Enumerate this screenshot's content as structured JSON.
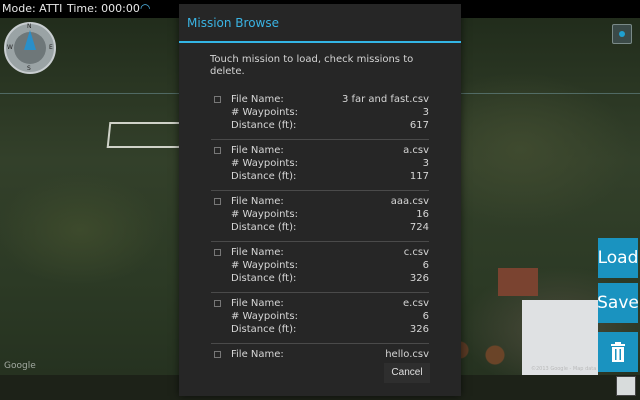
{
  "status": {
    "mode": "Mode: ATTI",
    "time": "Time: 000:00"
  },
  "compass": {
    "n": "N",
    "e": "E",
    "s": "S",
    "w": "W"
  },
  "dialog": {
    "title": "Mission Browse",
    "instructions": "Touch mission to load, check missions to delete.",
    "labels": {
      "file": "File Name:",
      "waypoints": "# Waypoints:",
      "distance": "Distance (ft):"
    },
    "missions": [
      {
        "file": "3 far and fast.csv",
        "waypoints": "3",
        "distance": "617"
      },
      {
        "file": "a.csv",
        "waypoints": "3",
        "distance": "117"
      },
      {
        "file": "aaa.csv",
        "waypoints": "16",
        "distance": "724"
      },
      {
        "file": "c.csv",
        "waypoints": "6",
        "distance": "326"
      },
      {
        "file": "e.csv",
        "waypoints": "6",
        "distance": "326"
      },
      {
        "file": "hello.csv"
      }
    ],
    "cancel": "Cancel"
  },
  "controls": {
    "load": "Load",
    "save": "Save"
  },
  "map": {
    "attribution": "Google",
    "copyright": "©2013 Google - Map data"
  },
  "colors": {
    "accent": "#33b5e5",
    "button": "#1a93c0",
    "dialog_bg": "#262626"
  }
}
